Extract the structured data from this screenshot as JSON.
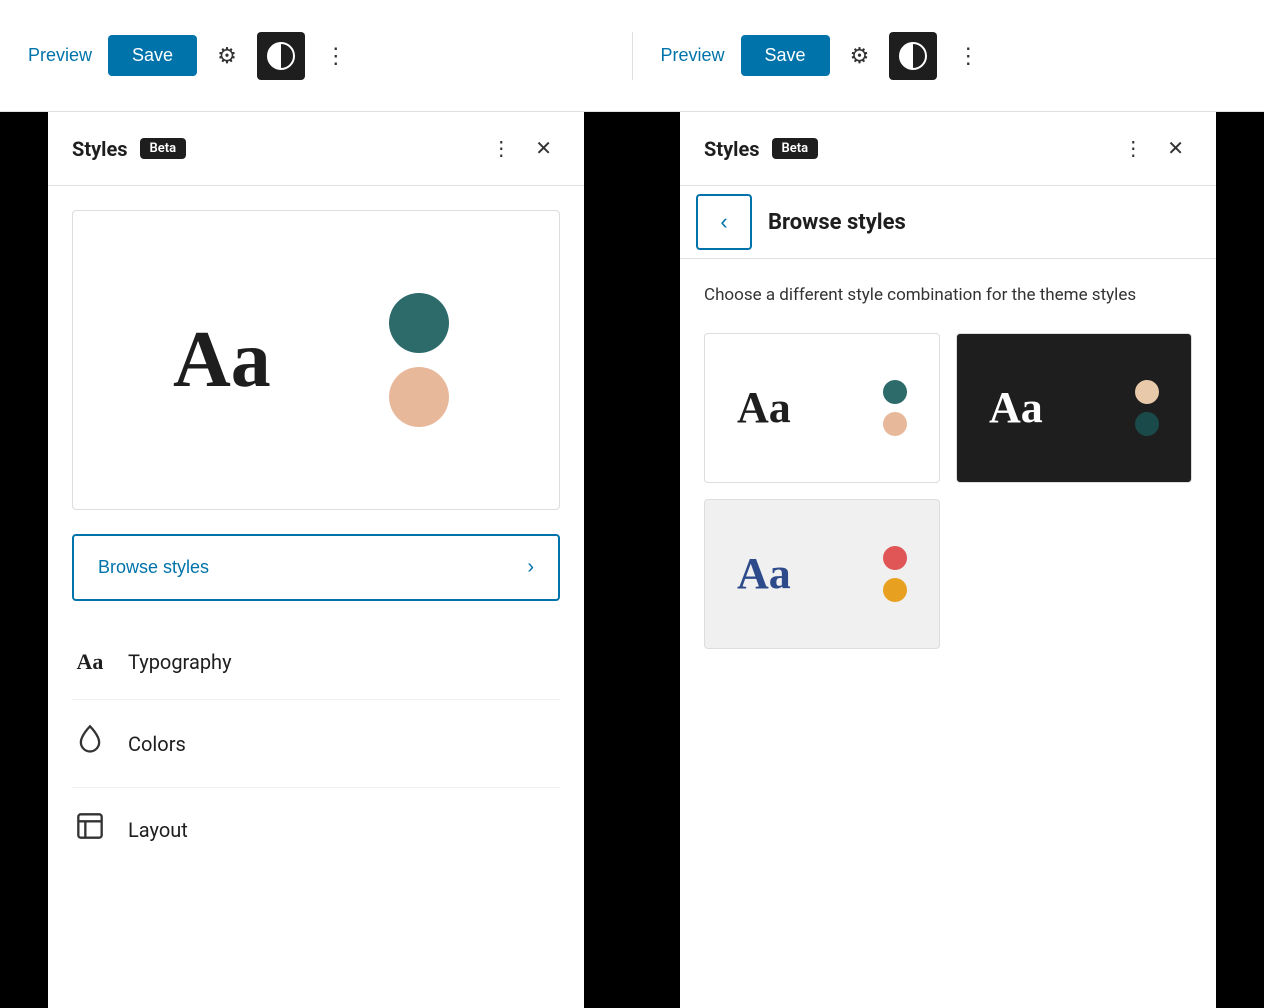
{
  "toolbar": {
    "preview_label": "Preview",
    "save_label": "Save"
  },
  "left_panel": {
    "title": "Styles",
    "beta_label": "Beta",
    "preview_text": "Aa",
    "browse_styles_label": "Browse styles",
    "items": [
      {
        "id": "typography",
        "label": "Typography",
        "icon_text": "Aa"
      },
      {
        "id": "colors",
        "label": "Colors",
        "icon_type": "droplet"
      },
      {
        "id": "layout",
        "label": "Layout",
        "icon_type": "layout"
      }
    ]
  },
  "right_panel": {
    "title": "Styles",
    "beta_label": "Beta",
    "browse_title": "Browse styles",
    "browse_description": "Choose a different style combination for the theme styles",
    "style_cards": [
      {
        "id": "light",
        "theme": "white",
        "aa_color": "dark",
        "circle1": "teal",
        "circle2": "peach"
      },
      {
        "id": "dark",
        "theme": "dark",
        "aa_color": "light",
        "circle1": "peach-light",
        "circle2": "teal-dark"
      },
      {
        "id": "colorful",
        "theme": "light-gray",
        "aa_color": "blue",
        "circle1": "red",
        "circle2": "orange"
      }
    ]
  }
}
